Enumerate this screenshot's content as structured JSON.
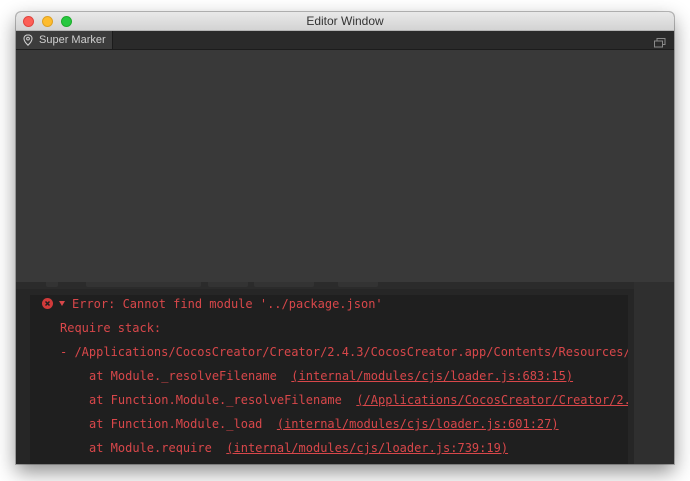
{
  "window": {
    "title": "Editor Window"
  },
  "tab": {
    "label": "Super Marker",
    "icon": "location-pin-icon"
  },
  "console": {
    "error_title": "Error: Cannot find module '../package.json'",
    "require_stack": "Require stack:",
    "stack_path": "- /Applications/CocosCreator/Creator/2.4.3/CocosCreator.app/Contents/Resources/",
    "frames": [
      {
        "fn": "at Module._resolveFilename",
        "loc": "(internal/modules/cjs/loader.js:683:15)"
      },
      {
        "fn": "at Function.Module._resolveFilename",
        "loc": "(/Applications/CocosCreator/Creator/2."
      },
      {
        "fn": "at Function.Module._load",
        "loc": "(internal/modules/cjs/loader.js:601:27)"
      },
      {
        "fn": "at Module.require",
        "loc": "(internal/modules/cjs/loader.js:739:19)"
      }
    ],
    "error_color": "#d8474a"
  }
}
